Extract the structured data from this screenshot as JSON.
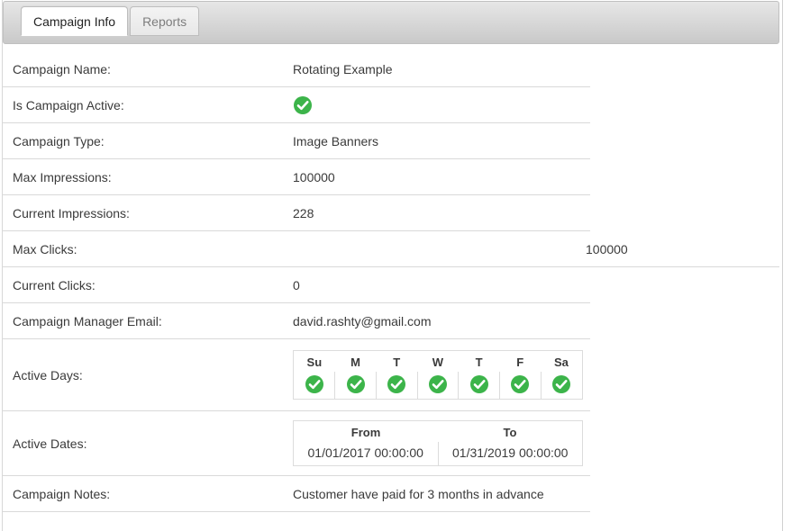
{
  "window": {
    "title": "Campaign Info"
  },
  "tabs": [
    {
      "label": "Campaign Info",
      "active": true
    },
    {
      "label": "Reports",
      "active": false
    }
  ],
  "colors": {
    "check_green": "#3cb44a",
    "tab_bar_top": "#e6e6e6",
    "tab_bar_bottom": "#c9c9c9",
    "row_border": "#d9d9d9",
    "text": "#3a3a3a"
  },
  "fields": [
    {
      "label": "Campaign Name:",
      "value": "Rotating Example",
      "type": "text"
    },
    {
      "label": "Is Campaign Active:",
      "value": "check-circle-icon",
      "type": "check"
    },
    {
      "label": "Campaign Type:",
      "value": "Image Banners",
      "type": "text"
    },
    {
      "label": "Max Impressions:",
      "value": "100000",
      "type": "text"
    },
    {
      "label": "Current Impressions:",
      "value": "228",
      "type": "text"
    },
    {
      "label": "Max Clicks:",
      "value": "100000",
      "type": "text-offset"
    },
    {
      "label": "Current Clicks:",
      "value": "0",
      "type": "text"
    },
    {
      "label": "Campaign Manager Email:",
      "value": "david.rashty@gmail.com",
      "type": "text"
    },
    {
      "label": "Active Days:",
      "value": "",
      "type": "days-table"
    },
    {
      "label": "Active Dates:",
      "value": "",
      "type": "dates-table"
    },
    {
      "label": "Campaign Notes:",
      "value": "Customer have paid for 3 months in advance",
      "type": "text"
    }
  ],
  "active_days": {
    "headers": [
      "Su",
      "M",
      "T",
      "W",
      "T",
      "F",
      "Sa"
    ],
    "values": [
      true,
      true,
      true,
      true,
      true,
      true,
      true
    ],
    "icon": "check-circle-icon"
  },
  "active_dates": {
    "headers": [
      "From",
      "To"
    ],
    "values": [
      "01/01/2017 00:00:00",
      "01/31/2019 00:00:00"
    ]
  }
}
